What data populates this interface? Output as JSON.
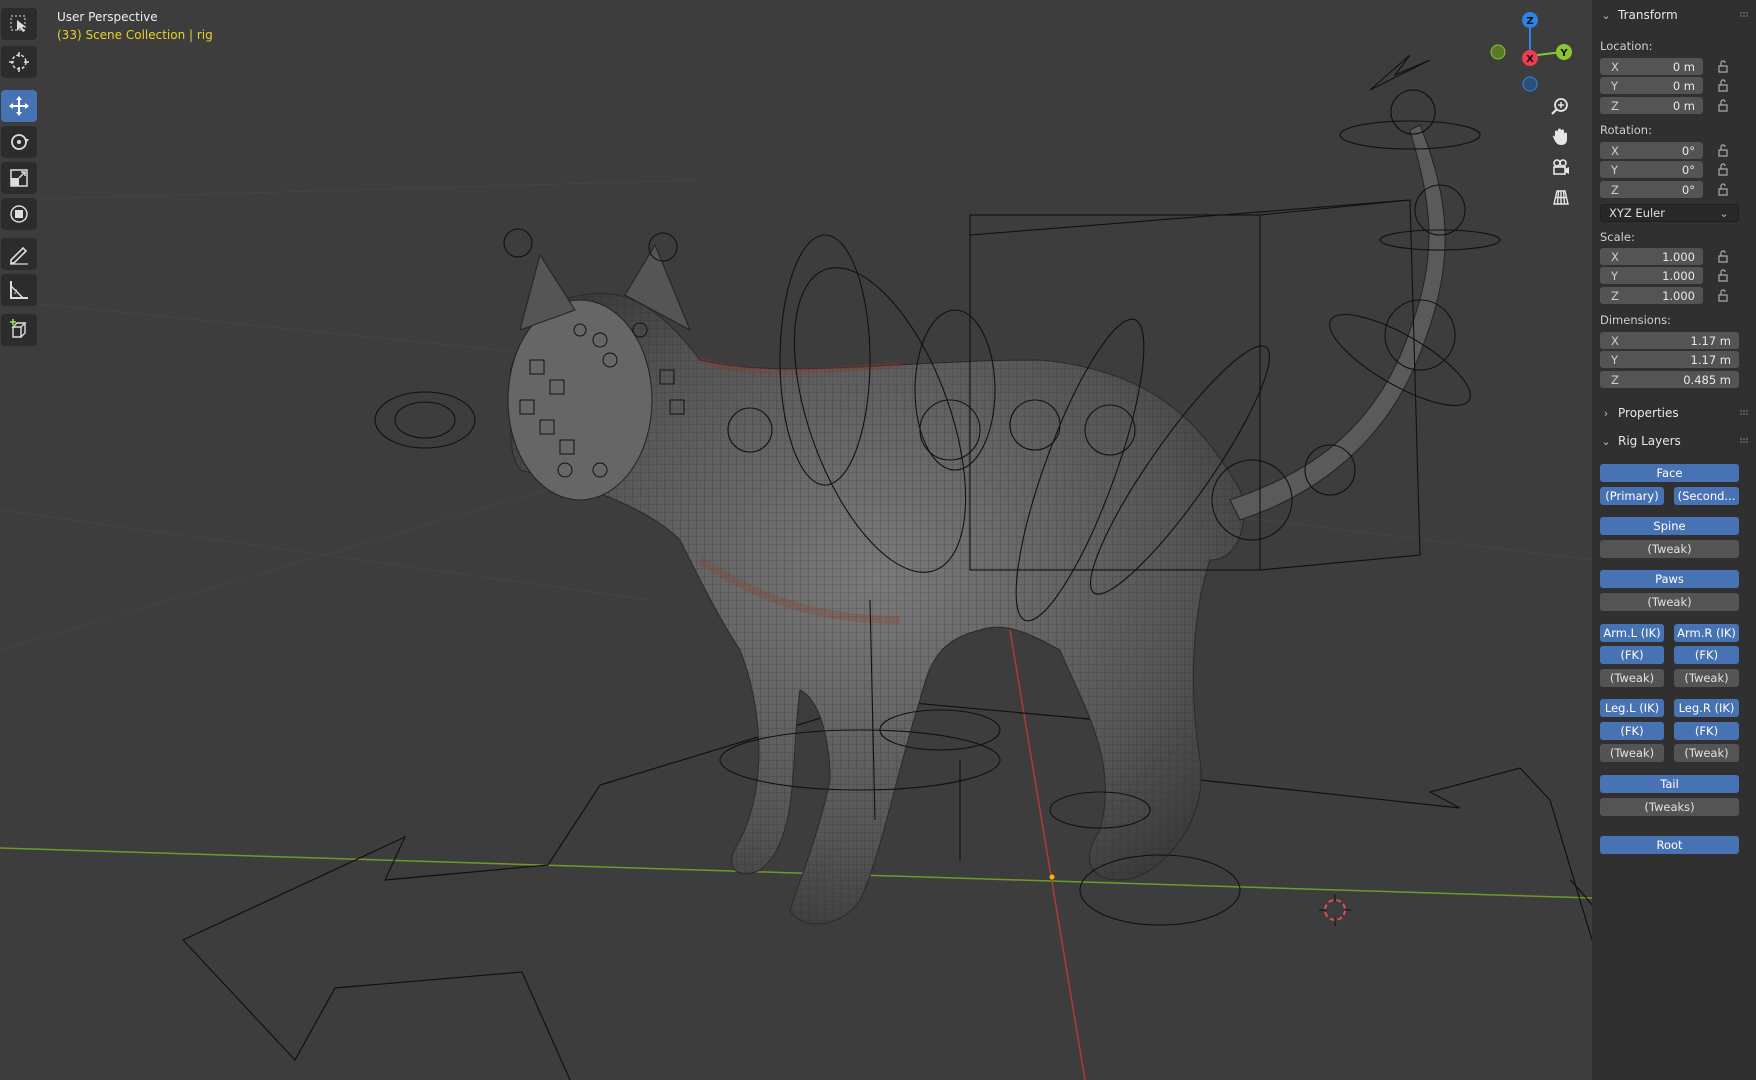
{
  "viewport": {
    "title": "User Perspective",
    "subtitle": "(33) Scene Collection | rig",
    "background": "#3d3d3d"
  },
  "toolbar": {
    "tools": [
      {
        "name": "select-box",
        "active": false
      },
      {
        "name": "cursor",
        "active": false
      },
      {
        "name": "move",
        "active": true
      },
      {
        "name": "rotate",
        "active": false
      },
      {
        "name": "scale",
        "active": false
      },
      {
        "name": "transform",
        "active": false
      },
      {
        "name": "annotate",
        "active": false
      },
      {
        "name": "measure",
        "active": false
      },
      {
        "name": "add-cube",
        "active": false
      }
    ]
  },
  "gizmo": {
    "x_label": "X",
    "y_label": "Y",
    "z_label": "Z",
    "x_color": "#f03c4f",
    "y_color": "#8bc530",
    "z_color": "#2f83e8"
  },
  "panel": {
    "transform": {
      "header": "Transform",
      "location_label": "Location:",
      "location": [
        {
          "axis": "X",
          "value": "0 m"
        },
        {
          "axis": "Y",
          "value": "0 m"
        },
        {
          "axis": "Z",
          "value": "0 m"
        }
      ],
      "rotation_label": "Rotation:",
      "rotation": [
        {
          "axis": "X",
          "value": "0°"
        },
        {
          "axis": "Y",
          "value": "0°"
        },
        {
          "axis": "Z",
          "value": "0°"
        }
      ],
      "rotation_mode": "XYZ Euler",
      "scale_label": "Scale:",
      "scale": [
        {
          "axis": "X",
          "value": "1.000"
        },
        {
          "axis": "Y",
          "value": "1.000"
        },
        {
          "axis": "Z",
          "value": "1.000"
        }
      ],
      "dimensions_label": "Dimensions:",
      "dimensions": [
        {
          "axis": "X",
          "value": "1.17 m"
        },
        {
          "axis": "Y",
          "value": "1.17 m"
        },
        {
          "axis": "Z",
          "value": "0.485 m"
        }
      ]
    },
    "properties_header": "Properties",
    "rig_layers": {
      "header": "Rig Layers",
      "face": "Face",
      "face_primary": "(Primary)",
      "face_secondary": "(Second...",
      "spine": "Spine",
      "spine_tweak": "(Tweak)",
      "paws": "Paws",
      "paws_tweak": "(Tweak)",
      "arm_l_ik": "Arm.L (IK)",
      "arm_r_ik": "Arm.R (IK)",
      "arm_l_fk": "(FK)",
      "arm_r_fk": "(FK)",
      "arm_l_tweak": "(Tweak)",
      "arm_r_tweak": "(Tweak)",
      "leg_l_ik": "Leg.L (IK)",
      "leg_r_ik": "Leg.R (IK)",
      "leg_l_fk": "(FK)",
      "leg_r_fk": "(FK)",
      "leg_l_tweak": "(Tweak)",
      "leg_r_tweak": "(Tweak)",
      "tail": "Tail",
      "tail_tweaks": "(Tweaks)",
      "root": "Root"
    },
    "colors": {
      "panel_bg": "#303030",
      "field_bg": "#545454",
      "active_button": "#4772b3"
    }
  }
}
